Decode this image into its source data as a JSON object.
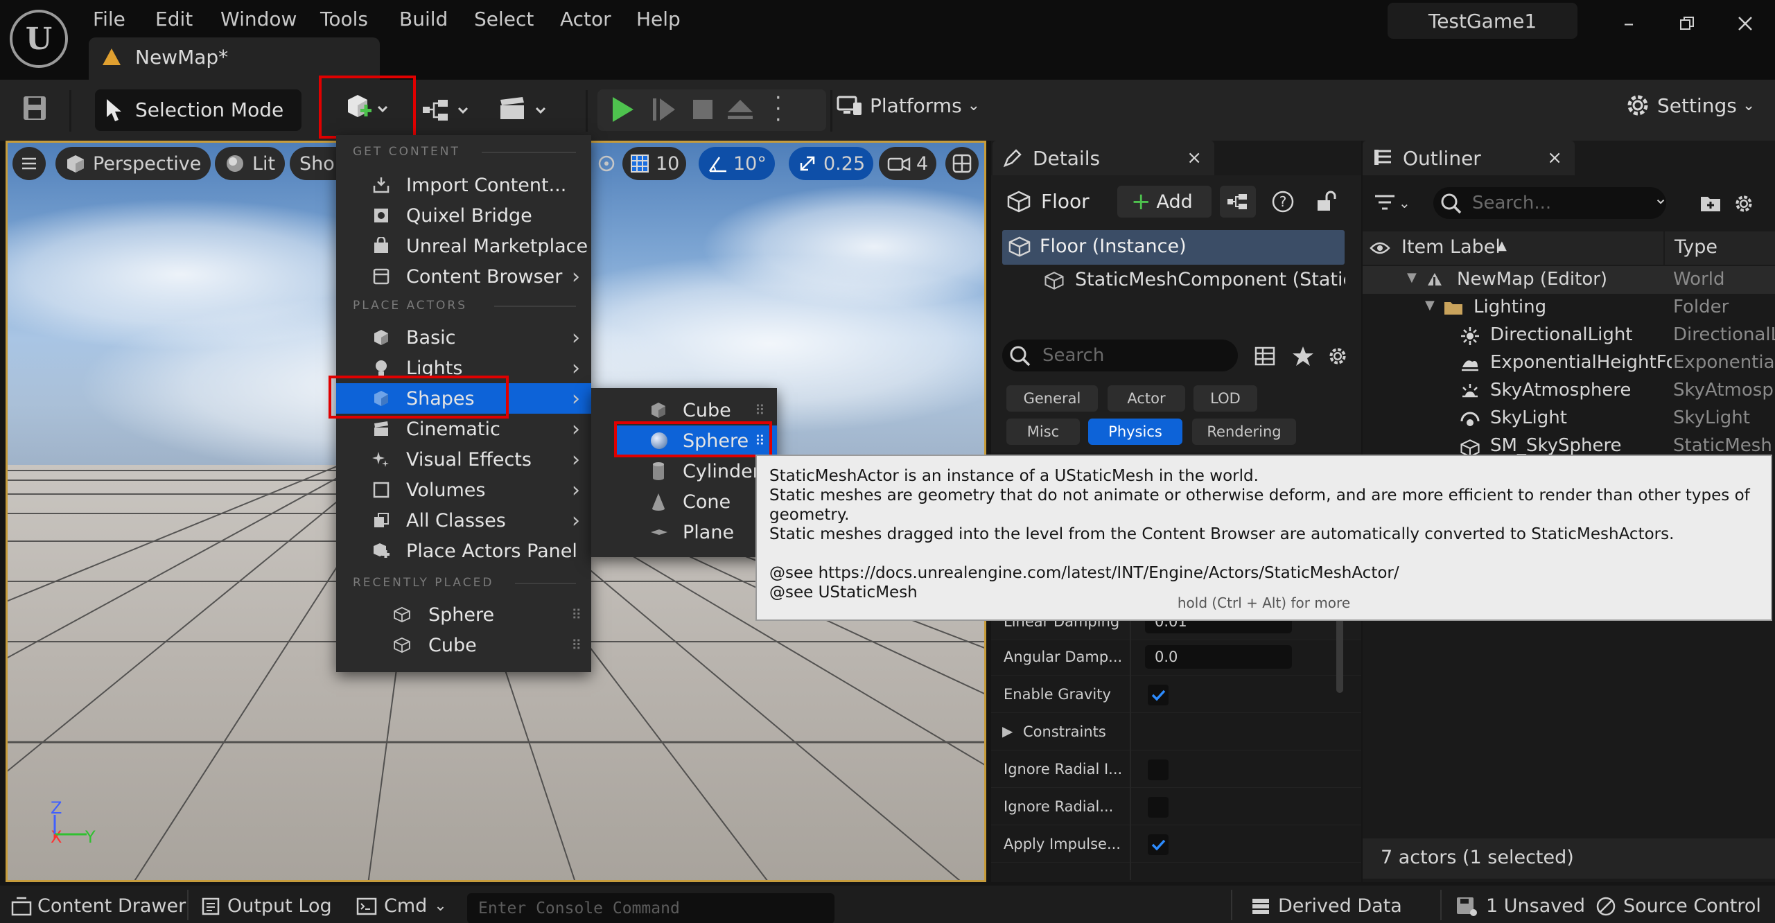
{
  "menubar": {
    "items": [
      "File",
      "Edit",
      "Window",
      "Tools",
      "Build",
      "Select",
      "Actor",
      "Help"
    ],
    "map_tab": "NewMap*",
    "project": "TestGame1"
  },
  "toolbar": {
    "selection_mode": "Selection Mode",
    "platforms": "Platforms",
    "settings": "Settings"
  },
  "viewport": {
    "perspective": "Perspective",
    "lit": "Lit",
    "show": "Sho",
    "grid_snap": "10",
    "rot_snap": "10°",
    "scale_snap": "0.25",
    "cam_speed": "4",
    "axis_z": "Z",
    "axis_x": "X",
    "axis_y": "Y"
  },
  "add_menu": {
    "sec_get": "GET CONTENT",
    "import": "Import Content...",
    "quixel": "Quixel Bridge",
    "marketplace": "Unreal Marketplace",
    "content_browser": "Content Browser",
    "sec_place": "PLACE ACTORS",
    "basic": "Basic",
    "lights": "Lights",
    "shapes": "Shapes",
    "cinematic": "Cinematic",
    "vfx": "Visual Effects",
    "volumes": "Volumes",
    "all_classes": "All Classes",
    "place_panel": "Place Actors Panel",
    "sec_recent": "RECENTLY PLACED",
    "recent_1": "Sphere",
    "recent_2": "Cube"
  },
  "shapes_menu": {
    "cube": "Cube",
    "sphere": "Sphere",
    "cylinder": "Cylinder",
    "cone": "Cone",
    "plane": "Plane"
  },
  "tooltip": {
    "line1": "StaticMeshActor is an instance of a UStaticMesh in the world.",
    "line2": "Static meshes are geometry that do not animate or otherwise deform, and are more efficient to render than other types of geometry.",
    "line3": "Static meshes dragged into the level from the Content Browser are automatically converted to StaticMeshActors.",
    "line4": "@see https://docs.unrealengine.com/latest/INT/Engine/Actors/StaticMeshActor/",
    "line5": "@see UStaticMesh",
    "more": "hold (Ctrl + Alt) for more"
  },
  "details": {
    "tab": "Details",
    "actor_name": "Floor",
    "add": "Add",
    "instance": "Floor (Instance)",
    "component": "StaticMeshComponent (StaticM",
    "search_placeholder": "Search",
    "filters": [
      "General",
      "Actor",
      "LOD",
      "Misc",
      "Physics",
      "Rendering"
    ],
    "active_filter": "Physics",
    "rows": {
      "linear_damping_label": "Linear Damping",
      "linear_damping_value": "0.01",
      "angular_damping_label": "Angular Damp...",
      "angular_damping_value": "0.0",
      "enable_gravity_label": "Enable Gravity",
      "enable_gravity_checked": true,
      "constraints_label": "Constraints",
      "ignore_radial_impulse_label": "Ignore Radial I...",
      "ignore_radial_force_label": "Ignore Radial...",
      "apply_impulse_label": "Apply Impulse...",
      "apply_impulse_checked": true
    }
  },
  "outliner": {
    "tab": "Outliner",
    "search_placeholder": "Search...",
    "col_label": "Item Label",
    "col_type": "Type",
    "rows": [
      {
        "label": "NewMap (Editor)",
        "type": "World"
      },
      {
        "label": "Lighting",
        "type": "Folder"
      },
      {
        "label": "DirectionalLight",
        "type": "DirectionalL"
      },
      {
        "label": "ExponentialHeightFo",
        "type": "Exponential"
      },
      {
        "label": "SkyAtmosphere",
        "type": "SkyAtmosp"
      },
      {
        "label": "SkyLight",
        "type": "SkyLight"
      },
      {
        "label": "SM_SkySphere",
        "type": "StaticMesh"
      }
    ],
    "footer": "7 actors (1 selected)"
  },
  "statusbar": {
    "content_drawer": "Content Drawer",
    "output_log": "Output Log",
    "cmd": "Cmd",
    "console_placeholder": "Enter Console Command",
    "derived_data": "Derived Data",
    "unsaved": "1 Unsaved",
    "source_control": "Source Control"
  }
}
